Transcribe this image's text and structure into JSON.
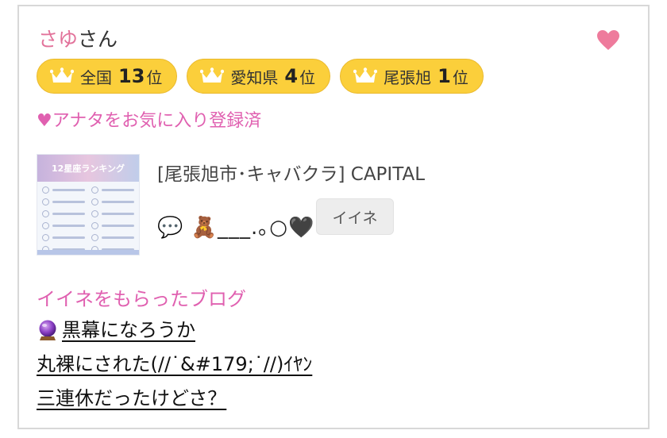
{
  "profile": {
    "name": "さゆ",
    "name_suffix": "さん",
    "favorite_icon": "heart-icon",
    "accent_color": "#e2729a"
  },
  "ranks": [
    {
      "region": "全国",
      "number": "13",
      "unit": "位",
      "icon": "crown-icon"
    },
    {
      "region": "愛知県",
      "number": "4",
      "unit": "位",
      "icon": "crown-icon"
    },
    {
      "region": "尾張旭",
      "number": "1",
      "unit": "位",
      "icon": "crown-icon"
    }
  ],
  "favorite_status": "♥アナタをお気に入り登録済",
  "post": {
    "shop": "[尾張旭市･キャバクラ]  CAPITAL",
    "status": "💬 🧸___.｡○🖤",
    "iine_label": "イイネ",
    "thumbnail_title": "12星座ランキング"
  },
  "blog": {
    "heading": "イイネをもらったブログ",
    "links": [
      {
        "icon": "crystal-ball-icon",
        "title": "黒幕になろうか"
      },
      {
        "title": "丸裸にされた(//˙&#179;˙//)ｲﾔﾝ"
      },
      {
        "title": "三連休だったけどさ？"
      }
    ]
  },
  "colors": {
    "pink": "#e060b0",
    "badge_gold": "#fbcf3b",
    "button_gray": "#ededed"
  }
}
